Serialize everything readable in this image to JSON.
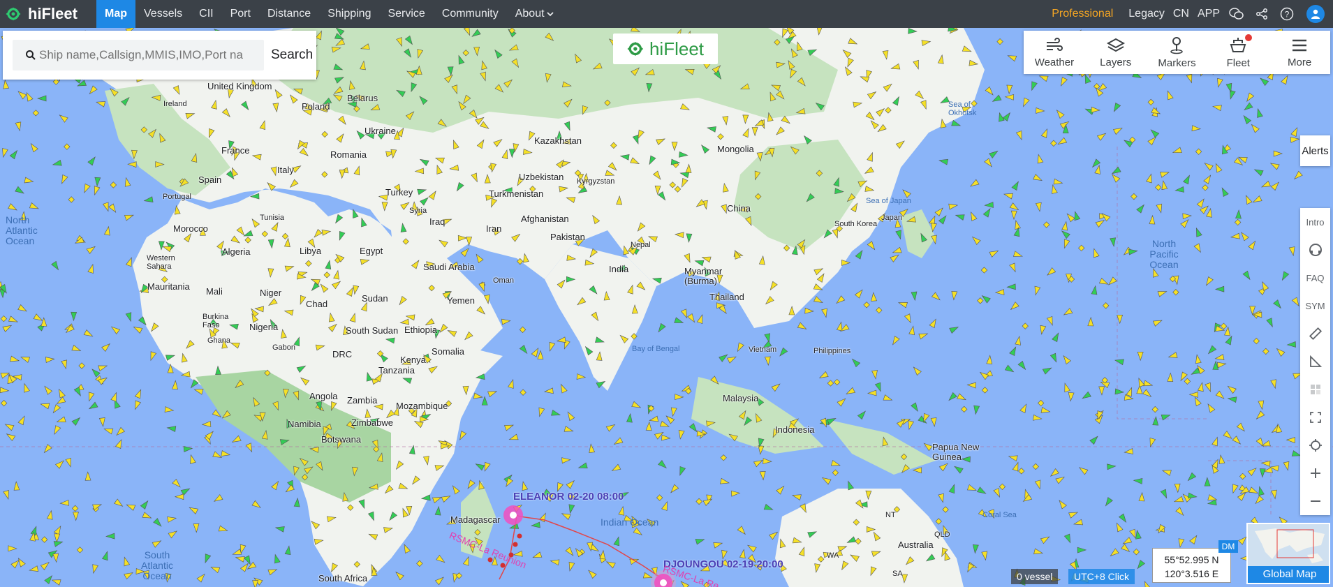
{
  "brand": {
    "name": "hiFleet"
  },
  "nav": {
    "items": [
      {
        "label": "Map",
        "active": true
      },
      {
        "label": "Vessels"
      },
      {
        "label": "CII"
      },
      {
        "label": "Port"
      },
      {
        "label": "Distance"
      },
      {
        "label": "Shipping"
      },
      {
        "label": "Service"
      },
      {
        "label": "Community"
      },
      {
        "label": "About"
      }
    ],
    "about_caret_icon": "chevron-down-icon",
    "right": {
      "professional": "Professional",
      "legacy": "Legacy",
      "cn": "CN",
      "app": "APP"
    },
    "icons": [
      "wechat-icon",
      "share-icon",
      "help-icon",
      "user-icon"
    ]
  },
  "search": {
    "placeholder": "Ship name,Callsign,MMIS,IMO,Port na",
    "button": "Search"
  },
  "center_logo": "hiFleet",
  "tools": [
    {
      "label": "Weather",
      "icon": "wind-icon"
    },
    {
      "label": "Layers",
      "icon": "layers-icon"
    },
    {
      "label": "Markers",
      "icon": "marker-icon"
    },
    {
      "label": "Fleet",
      "icon": "ship-icon",
      "badge": true
    },
    {
      "label": "More",
      "icon": "menu-icon"
    }
  ],
  "alerts": "Alerts",
  "sidebar": {
    "intro": "Intro",
    "faq": "FAQ",
    "sym": "SYM",
    "icons": [
      "support-icon",
      "ruler-icon",
      "angle-icon",
      "grid-icon",
      "fullscreen-icon",
      "locate-icon",
      "zoom-in-icon",
      "zoom-out-icon"
    ]
  },
  "map_labels": {
    "countries": [
      "United Kingdom",
      "Ireland",
      "Poland",
      "Belarus",
      "Ukraine",
      "Kazakhstan",
      "Mongolia",
      "France",
      "Romania",
      "Spain",
      "Portugal",
      "Italy",
      "Uzbekistan",
      "Kyrgyzstan",
      "Turkmenistan",
      "Turkey",
      "Syria",
      "Tunisia",
      "Iraq",
      "Iran",
      "Afghanistan",
      "China",
      "Morocco",
      "Algeria",
      "Libya",
      "Egypt",
      "Saudi Arabia",
      "Pakistan",
      "Nepal",
      "India",
      "Western Sahara",
      "Mauritania",
      "Mali",
      "Niger",
      "Chad",
      "Sudan",
      "Oman",
      "Yemen",
      "Myanmar (Burma)",
      "Thailand",
      "Burkina Faso",
      "Ghana",
      "Nigeria",
      "South Sudan",
      "Ethiopia",
      "Somalia",
      "Kenya",
      "Gabon",
      "DRC",
      "Tanzania",
      "Angola",
      "Zambia",
      "Mozambique",
      "Zimbabwe",
      "Namibia",
      "Botswana",
      "Madagascar",
      "South Africa",
      "Malaysia",
      "Indonesia",
      "Papua New Guinea",
      "Australia",
      "Vietnam",
      "Philippines",
      "South Korea",
      "Japan"
    ],
    "seas": [
      "North Atlantic Ocean",
      "North Pacific Ocean",
      "Sea of Okhotsk",
      "Sea of Japan",
      "Bay of Bengal",
      "Indian Ocean",
      "South Atlantic Ocean",
      "Coral Sea"
    ],
    "states": [
      "NT",
      "QLD",
      "WA",
      "SA"
    ]
  },
  "typhoons": [
    {
      "name": "ELEANOR 02-20 08:00",
      "track": "RSMC-La Reunion"
    },
    {
      "name": "DJOUNGOU 02-19 20:00",
      "track": "RSMC-La Re"
    }
  ],
  "status": {
    "vessel_count": "0 vessel",
    "utc": "UTC+8 Click"
  },
  "coords": {
    "lat": "55°52.995 N",
    "lon": "120°3.516 E",
    "format": "DM"
  },
  "global_map": "Global Map",
  "colors": {
    "nav_bg": "#3b4148",
    "active_tab": "#1e88e5",
    "professional": "#f5a623",
    "ocean": "#8ab4f8",
    "land": "#f1f3ef",
    "vegetation": "#a8d5a2",
    "vessel_cargo": "#f5e027",
    "vessel_other": "#33cc55",
    "typhoon": "#f050c0"
  }
}
